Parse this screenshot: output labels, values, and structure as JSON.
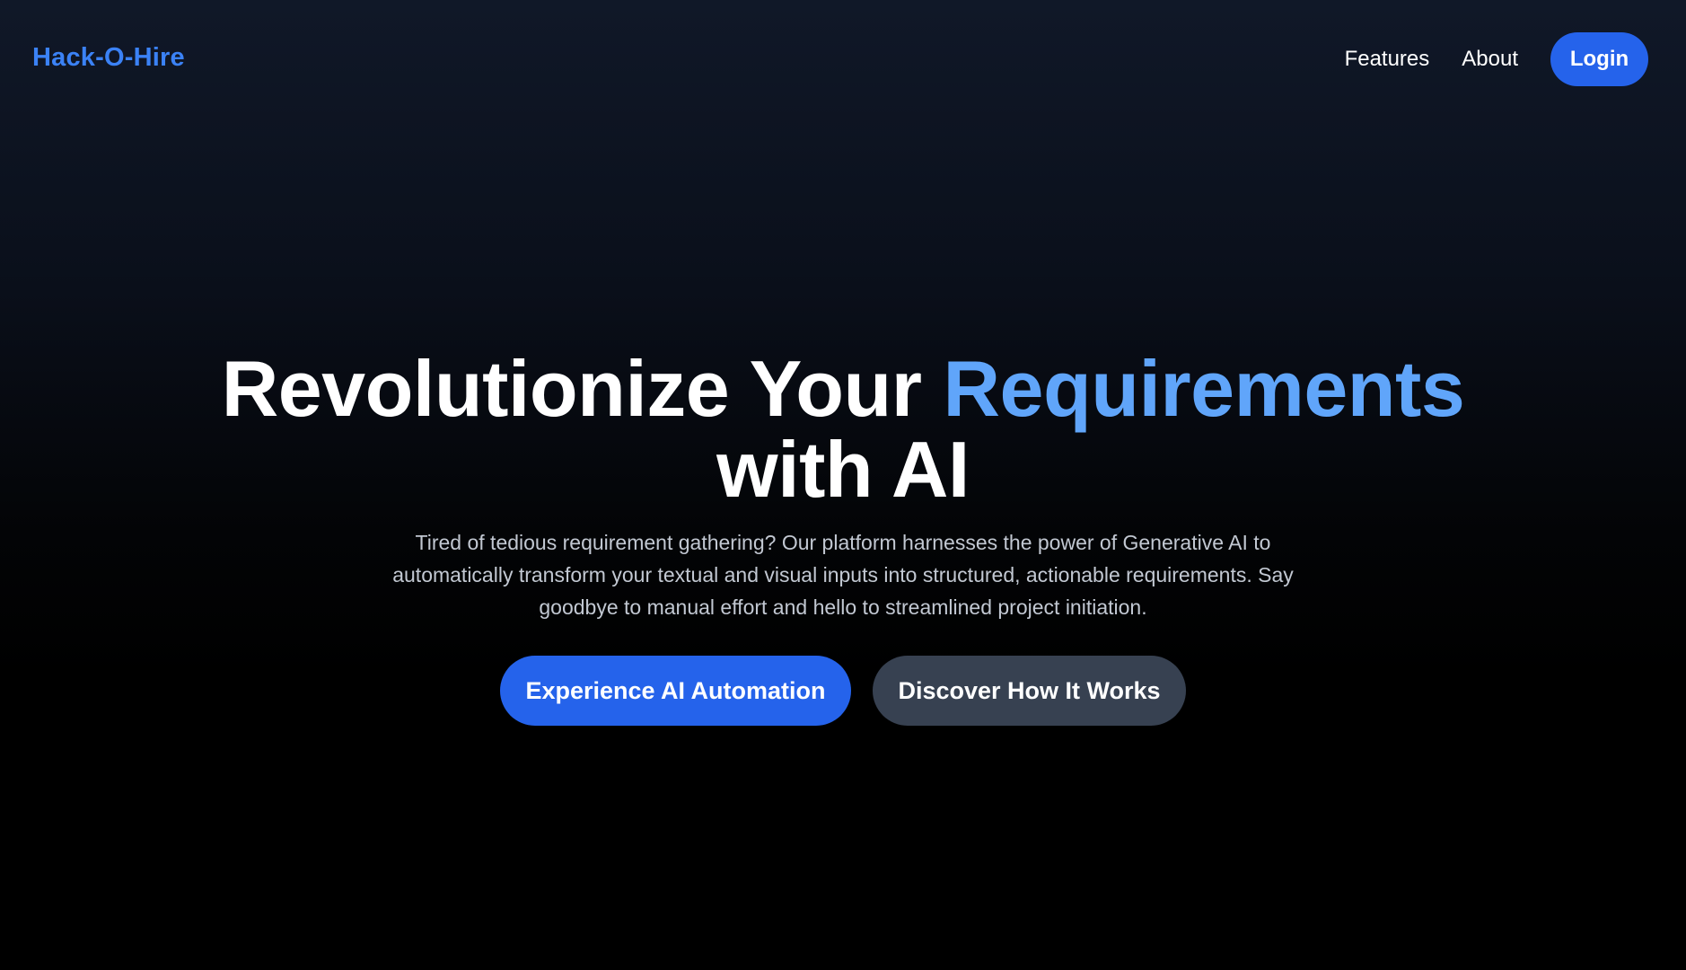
{
  "navbar": {
    "brand": "Hack-O-Hire",
    "links": [
      {
        "label": "Features"
      },
      {
        "label": "About"
      }
    ],
    "login_label": "Login"
  },
  "hero": {
    "title_part1": "Revolutionize Your ",
    "title_accent": "Requirements",
    "title_part2": "with AI",
    "description": "Tired of tedious requirement gathering? Our platform harnesses the power of Generative AI to automatically transform your textual and visual inputs into structured, actionable requirements. Say goodbye to manual effort and hello to streamlined project initiation.",
    "primary_cta": "Experience AI Automation",
    "secondary_cta": "Discover How It Works"
  },
  "colors": {
    "accent": "#3b82f6",
    "accent_light": "#60a5fa",
    "button_primary": "#2563eb",
    "button_secondary": "#374151",
    "background_top": "#101828",
    "background_bottom": "#000000"
  }
}
